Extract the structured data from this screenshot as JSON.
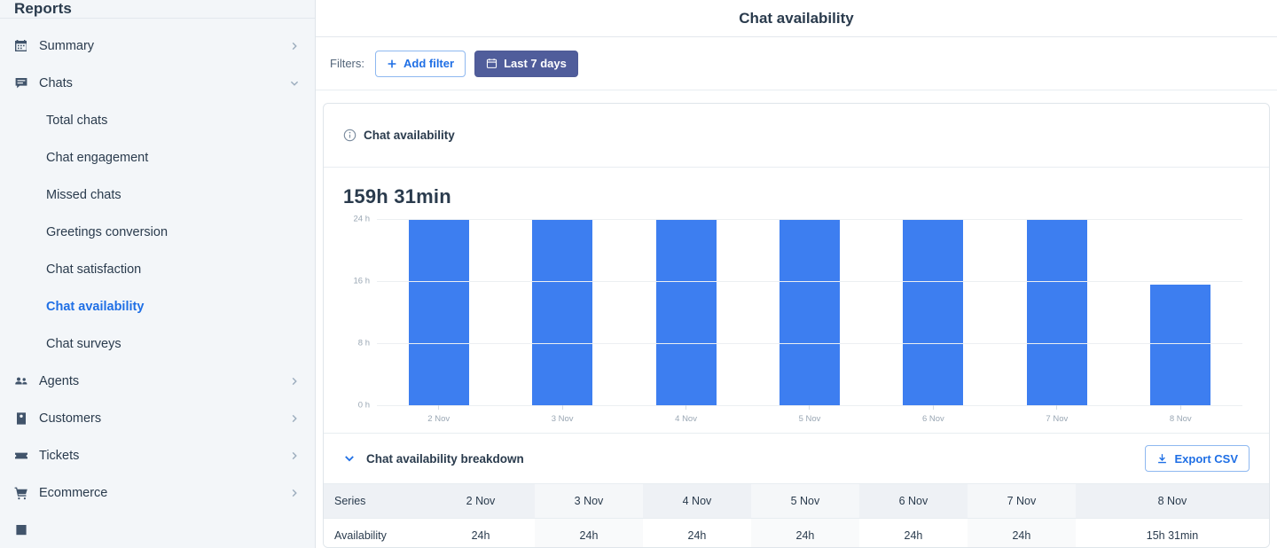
{
  "sidebar": {
    "header_title": "Reports",
    "items": [
      {
        "label": "Summary",
        "icon": "calendar-icon",
        "chevron": "right",
        "type": "parent"
      },
      {
        "label": "Chats",
        "icon": "chat-bubble-icon",
        "chevron": "down",
        "type": "parent"
      },
      {
        "label": "Total chats",
        "type": "child"
      },
      {
        "label": "Chat engagement",
        "type": "child"
      },
      {
        "label": "Missed chats",
        "type": "child"
      },
      {
        "label": "Greetings conversion",
        "type": "child"
      },
      {
        "label": "Chat satisfaction",
        "type": "child"
      },
      {
        "label": "Chat availability",
        "type": "child",
        "active": true
      },
      {
        "label": "Chat surveys",
        "type": "child"
      },
      {
        "label": "Agents",
        "icon": "people-icon",
        "chevron": "right",
        "type": "parent"
      },
      {
        "label": "Customers",
        "icon": "contact-card-icon",
        "chevron": "right",
        "type": "parent"
      },
      {
        "label": "Tickets",
        "icon": "ticket-icon",
        "chevron": "right",
        "type": "parent"
      },
      {
        "label": "Ecommerce",
        "icon": "cart-icon",
        "chevron": "right",
        "type": "parent"
      }
    ]
  },
  "header": {
    "title": "Chat availability"
  },
  "filters": {
    "label": "Filters:",
    "add_filter_label": "Add filter",
    "date_range_label": "Last 7 days"
  },
  "card": {
    "title": "Chat availability",
    "info_icon": "info-circle-icon",
    "metric_value": "159h 31min"
  },
  "breakdown": {
    "title": "Chat availability breakdown",
    "export_label": "Export CSV",
    "export_icon": "download-icon",
    "chevron_icon": "chevron-down-icon",
    "columns": [
      "Series",
      "2 Nov",
      "3 Nov",
      "4 Nov",
      "5 Nov",
      "6 Nov",
      "7 Nov",
      "8 Nov"
    ],
    "rows": [
      [
        "Availability",
        "24h",
        "24h",
        "24h",
        "24h",
        "24h",
        "24h",
        "15h 31min"
      ]
    ]
  },
  "chart_data": {
    "type": "bar",
    "title": "Chat availability",
    "categories": [
      "2 Nov",
      "3 Nov",
      "4 Nov",
      "5 Nov",
      "6 Nov",
      "7 Nov",
      "8 Nov"
    ],
    "values": [
      24,
      24,
      24,
      24,
      24,
      24,
      15.52
    ],
    "value_labels": [
      "24h",
      "24h",
      "24h",
      "24h",
      "24h",
      "24h",
      "15h 31min"
    ],
    "series_name": "Availability",
    "xlabel": "",
    "ylabel": "",
    "ylim": [
      0,
      24
    ],
    "ytick_values": [
      0,
      8,
      16,
      24
    ],
    "ytick_labels": [
      "0 h",
      "8 h",
      "16 h",
      "24 h"
    ],
    "grid": true,
    "legend": false,
    "bar_color": "#3d7ef0",
    "total": "159h 31min"
  }
}
